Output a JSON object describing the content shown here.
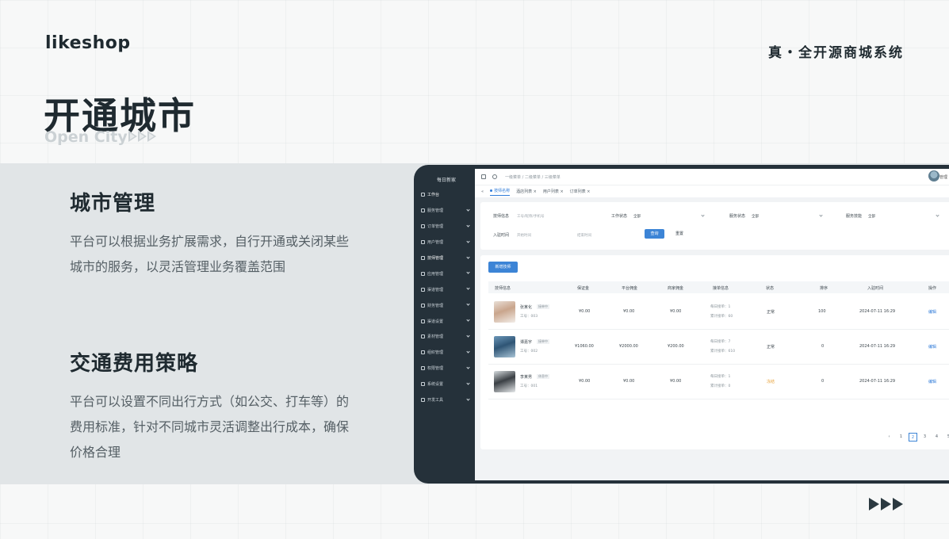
{
  "header": {
    "logo": "likeshop",
    "tagline": "真・全开源商城系统",
    "title": "开通城市",
    "subtitle": "Open City"
  },
  "features": [
    {
      "title": "城市管理",
      "desc_lines": [
        "平台可以根据业务扩展需求，自行开通或关闭某些",
        "城市的服务，以灵活管理业务覆盖范围"
      ]
    },
    {
      "title": "交通费用策略",
      "desc_lines": [
        "平台可以设置不同出行方式（如公交、打车等）的",
        "费用标准，针对不同城市灵活调整出行成本，确保",
        "价格合理"
      ]
    }
  ],
  "app": {
    "sidebar": {
      "title": "每日新家",
      "items": [
        "工作台",
        "服务管理",
        "订单管理",
        "用户管理",
        "技师管理",
        "应用管理",
        "渠道管理",
        "财务管理",
        "渠道设置",
        "素材管理",
        "组织管理",
        "权限管理",
        "系统设置",
        "开发工具"
      ]
    },
    "topbar": {
      "breadcrumb": "一级菜单 / 二级菜单 / 三级菜单",
      "user": "管理"
    },
    "tabs": [
      "技师名称",
      "酒店列表",
      "用户列表",
      "订单列表"
    ],
    "filter": {
      "name_label": "技师信息",
      "name_placeholder": "工号/昵称/手机号",
      "work_status_label": "工作状态",
      "work_status_value": "全部",
      "service_status_label": "服务状态",
      "service_status_value": "全部",
      "service_level_label": "服务技能",
      "service_level_value": "全部",
      "join_time_label": "入驻时间",
      "start_placeholder": "开始时间",
      "end_placeholder": "结束时间",
      "query_label": "查询",
      "reset_label": "重置"
    },
    "table": {
      "add_label": "新增技师",
      "headers": [
        "技师信息",
        "保证金",
        "平台佣金",
        "商家佣金",
        "接单信息",
        "状态",
        "排序",
        "入驻时间",
        "操作"
      ],
      "rows": [
        {
          "name": "张某化",
          "tag": "接单中",
          "id": "工号：003",
          "deposit": "¥0.00",
          "platform": "¥0.00",
          "merchant": "¥0.00",
          "today": "每日接单：1",
          "total": "累计接单：60",
          "status": "正常",
          "sort": "100",
          "time": "2024-07-11 16:29",
          "action": "编辑"
        },
        {
          "name": "谭嘉宇",
          "tag": "接单中",
          "id": "工号：002",
          "deposit": "¥1060.00",
          "platform": "¥2000.00",
          "merchant": "¥200.00",
          "today": "每日接单：7",
          "total": "累计接单：610",
          "status": "正常",
          "sort": "0",
          "time": "2024-07-11 16:29",
          "action": "编辑"
        },
        {
          "name": "李某男",
          "tag": "休息中",
          "id": "工号：001",
          "deposit": "¥0.00",
          "platform": "¥0.00",
          "merchant": "¥0.00",
          "today": "每日接单：1",
          "total": "累计接单：0",
          "status": "冻结",
          "sort": "0",
          "time": "2024-07-11 16:29",
          "action": "编辑"
        }
      ]
    },
    "pagination": {
      "prev": "‹",
      "pages": [
        "1",
        "2",
        "3",
        "4",
        "5"
      ],
      "current": "2"
    }
  },
  "colors": {
    "accent": "#3c84d6",
    "dark": "#25313a",
    "band": "#e1e5e7"
  }
}
